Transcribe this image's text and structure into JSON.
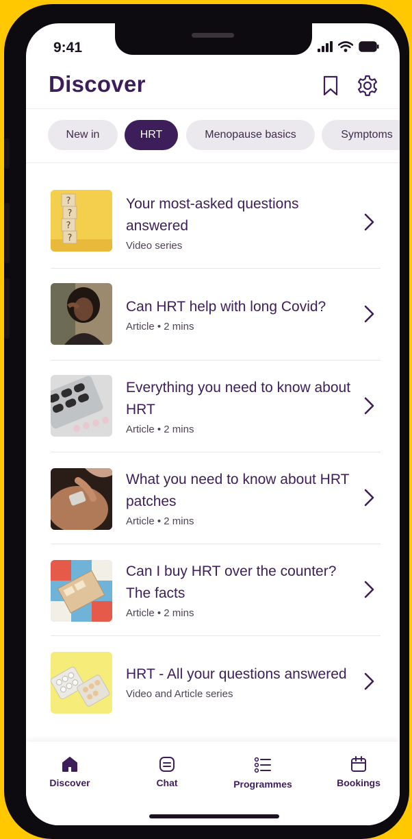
{
  "status_bar": {
    "time": "9:41"
  },
  "header": {
    "title": "Discover",
    "bookmark_icon": "bookmark-icon",
    "settings_icon": "gear-icon"
  },
  "filters": [
    {
      "label": "New in",
      "active": false
    },
    {
      "label": "HRT",
      "active": true
    },
    {
      "label": "Menopause basics",
      "active": false
    },
    {
      "label": "Symptoms",
      "active": false
    }
  ],
  "items": [
    {
      "title": "Your most-asked questions answered",
      "meta": "Video series"
    },
    {
      "title": "Can HRT help with long Covid?",
      "meta": "Article • 2 mins"
    },
    {
      "title": "Everything you need to know about HRT",
      "meta": "Article • 2 mins"
    },
    {
      "title": "What you need to know about HRT patches",
      "meta": "Article • 2 mins"
    },
    {
      "title": "Can I buy HRT over the counter? The facts",
      "meta": "Article • 2 mins"
    },
    {
      "title": "HRT - All your questions answered",
      "meta": "Video and Article series"
    }
  ],
  "tabbar": [
    {
      "label": "Discover",
      "icon": "home-icon"
    },
    {
      "label": "Chat",
      "icon": "chat-icon"
    },
    {
      "label": "Programmes",
      "icon": "list-icon"
    },
    {
      "label": "Bookings",
      "icon": "calendar-icon"
    }
  ],
  "colors": {
    "background": "#FFC800",
    "primary": "#3D1E5A",
    "chip": "#ECE9EE"
  }
}
